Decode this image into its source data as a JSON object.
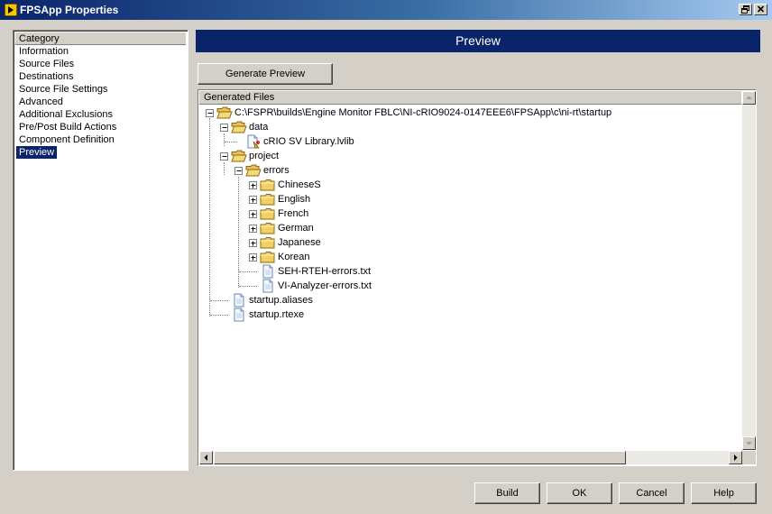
{
  "window": {
    "title": "FPSApp Properties"
  },
  "category": {
    "header": "Category",
    "items": [
      {
        "label": "Information"
      },
      {
        "label": "Source Files"
      },
      {
        "label": "Destinations"
      },
      {
        "label": "Source File Settings"
      },
      {
        "label": "Advanced"
      },
      {
        "label": "Additional Exclusions"
      },
      {
        "label": "Pre/Post Build Actions"
      },
      {
        "label": "Component Definition"
      },
      {
        "label": "Preview",
        "selected": true
      }
    ]
  },
  "preview": {
    "header": "Preview",
    "generate_button": "Generate Preview",
    "tree_header": "Generated Files",
    "tree": [
      {
        "label": "C:\\FSPR\\builds\\Engine Monitor FBLC\\NI-cRIO9024-0147EEE6\\FPSApp\\c\\ni-rt\\startup",
        "type": "folder",
        "expanded": true
      },
      {
        "label": "data",
        "type": "folder",
        "expanded": true
      },
      {
        "label": "cRIO SV Library.lvlib",
        "type": "library"
      },
      {
        "label": "project",
        "type": "folder",
        "expanded": true
      },
      {
        "label": "errors",
        "type": "folder",
        "expanded": true
      },
      {
        "label": "ChineseS",
        "type": "folder",
        "expanded": false
      },
      {
        "label": "English",
        "type": "folder",
        "expanded": false
      },
      {
        "label": "French",
        "type": "folder",
        "expanded": false
      },
      {
        "label": "German",
        "type": "folder",
        "expanded": false
      },
      {
        "label": "Japanese",
        "type": "folder",
        "expanded": false
      },
      {
        "label": "Korean",
        "type": "folder",
        "expanded": false
      },
      {
        "label": "SEH-RTEH-errors.txt",
        "type": "file"
      },
      {
        "label": "VI-Analyzer-errors.txt",
        "type": "file"
      },
      {
        "label": "startup.aliases",
        "type": "file"
      },
      {
        "label": "startup.rtexe",
        "type": "file"
      }
    ]
  },
  "footer": {
    "build": "Build",
    "ok": "OK",
    "cancel": "Cancel",
    "help": "Help"
  },
  "colors": {
    "selection": "#0a246a",
    "header_bg": "#0a246a",
    "face": "#d4d0c8",
    "folder": "#f2d067"
  }
}
